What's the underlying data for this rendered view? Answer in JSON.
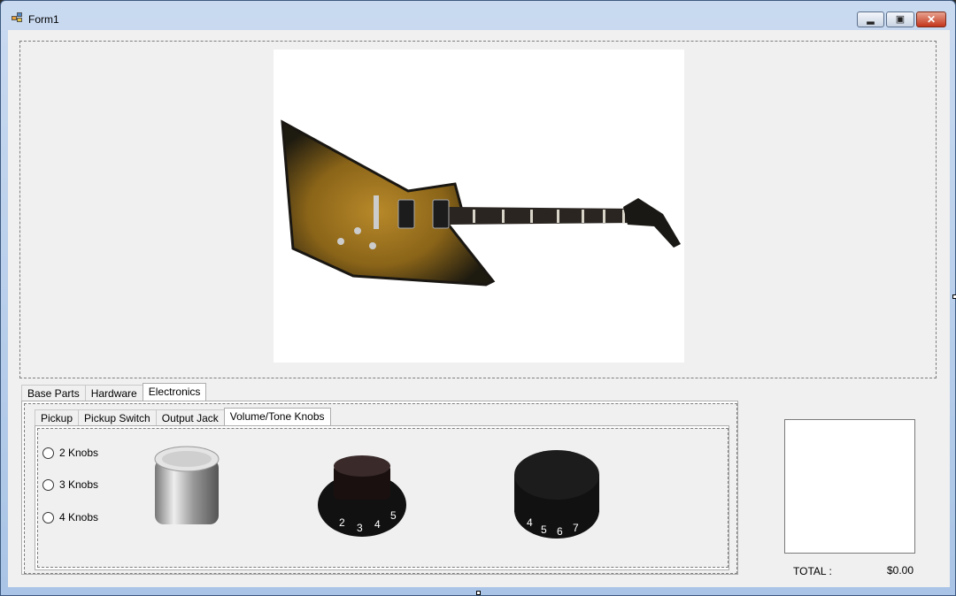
{
  "window": {
    "title": "Form1",
    "minimize_icon": "minimize-icon",
    "maximize_icon": "maximize-icon",
    "close_icon": "close-icon"
  },
  "main_picture": {
    "description_icon": "guitar-image"
  },
  "outer_tabs": [
    {
      "label": "Base Parts"
    },
    {
      "label": "Hardware"
    },
    {
      "label": "Electronics",
      "selected": true
    }
  ],
  "inner_tabs": [
    {
      "label": "Pickup"
    },
    {
      "label": "Pickup Switch"
    },
    {
      "label": "Output Jack"
    },
    {
      "label": "Volume/Tone Knobs",
      "selected": true
    }
  ],
  "knob_options": [
    {
      "label": "2 Knobs"
    },
    {
      "label": "3 Knobs"
    },
    {
      "label": "4 Knobs"
    }
  ],
  "knob_images": [
    "chrome-knob-image",
    "black-top-hat-knob-image",
    "black-speed-knob-image"
  ],
  "total": {
    "label": "TOTAL :",
    "value": "$0.00"
  },
  "colors": {
    "title_gradient": "#a9c4e6",
    "client_bg": "#f0f0f0",
    "close_red": "#c4351c"
  }
}
